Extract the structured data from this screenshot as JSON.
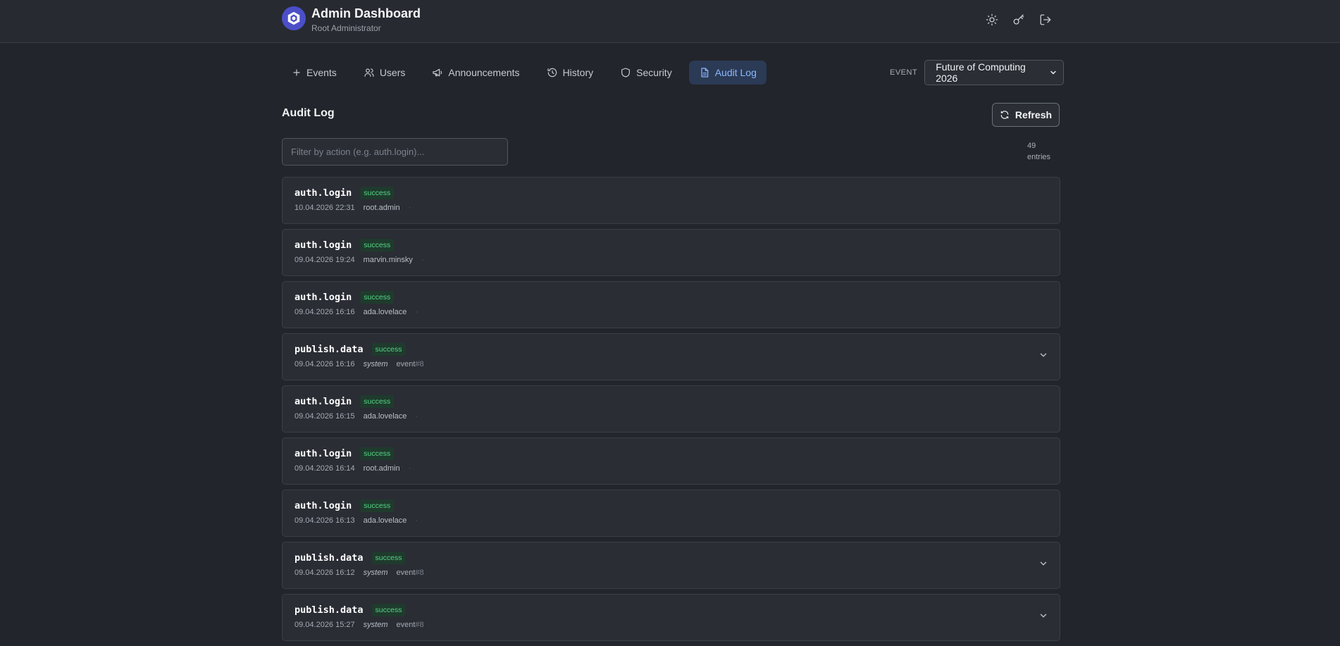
{
  "header": {
    "title": "Admin Dashboard",
    "subtitle": "Root Administrator",
    "actions": [
      {
        "name": "theme-toggle-button",
        "icon": "sun-icon"
      },
      {
        "name": "change-password-button",
        "icon": "key-icon"
      },
      {
        "name": "logout-button",
        "icon": "logout-icon"
      }
    ]
  },
  "tabs": [
    {
      "label": "Events",
      "icon": "plus-icon",
      "active": false
    },
    {
      "label": "Users",
      "icon": "users-icon",
      "active": false
    },
    {
      "label": "Announcements",
      "icon": "megaphone-icon",
      "active": false
    },
    {
      "label": "History",
      "icon": "history-icon",
      "active": false
    },
    {
      "label": "Security",
      "icon": "shield-icon",
      "active": true
    },
    {
      "label": "Audit Log",
      "icon": "document-icon",
      "active": true
    }
  ],
  "event_selector": {
    "label": "EVENT",
    "selected": "Future of Computing 2026"
  },
  "main": {
    "title": "Audit Log",
    "refresh_label": "Refresh",
    "filter_placeholder": "Filter by action (e.g. auth.login)...",
    "count_number": "49",
    "count_unit": "entries"
  },
  "entries": [
    {
      "action": "auth.login",
      "status": "success",
      "time": "10.04.2026 22:31",
      "user": "root.admin",
      "system": false,
      "target": "",
      "target_id": "",
      "expandable": false
    },
    {
      "action": "auth.login",
      "status": "success",
      "time": "09.04.2026 19:24",
      "user": "marvin.minsky",
      "system": false,
      "target": "",
      "target_id": "",
      "expandable": false
    },
    {
      "action": "auth.login",
      "status": "success",
      "time": "09.04.2026 16:16",
      "user": "ada.lovelace",
      "system": false,
      "target": "",
      "target_id": "",
      "expandable": false
    },
    {
      "action": "publish.data",
      "status": "success",
      "time": "09.04.2026 16:16",
      "user": "system",
      "system": true,
      "target": "event",
      "target_id": "#8",
      "expandable": true
    },
    {
      "action": "auth.login",
      "status": "success",
      "time": "09.04.2026 16:15",
      "user": "ada.lovelace",
      "system": false,
      "target": "",
      "target_id": "",
      "expandable": false
    },
    {
      "action": "auth.login",
      "status": "success",
      "time": "09.04.2026 16:14",
      "user": "root.admin",
      "system": false,
      "target": "",
      "target_id": "",
      "expandable": false
    },
    {
      "action": "auth.login",
      "status": "success",
      "time": "09.04.2026 16:13",
      "user": "ada.lovelace",
      "system": false,
      "target": "",
      "target_id": "",
      "expandable": false
    },
    {
      "action": "publish.data",
      "status": "success",
      "time": "09.04.2026 16:12",
      "user": "system",
      "system": true,
      "target": "event",
      "target_id": "#8",
      "expandable": true
    },
    {
      "action": "publish.data",
      "status": "success",
      "time": "09.04.2026 15:27",
      "user": "system",
      "system": true,
      "target": "event",
      "target_id": "#8",
      "expandable": true
    }
  ],
  "colors": {
    "background": "#22252b",
    "accent": "#8cb8ff",
    "success_text": "#54d486",
    "success_bg": "#1f3b2d"
  }
}
